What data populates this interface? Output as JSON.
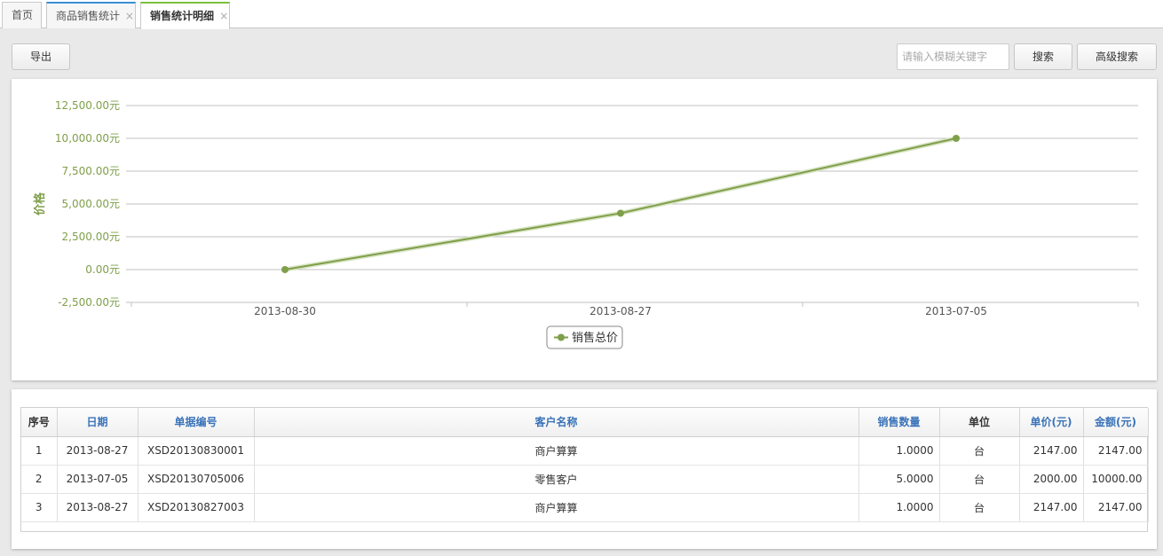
{
  "tabs": [
    {
      "label": "首页",
      "closable": false
    },
    {
      "label": "商品销售统计",
      "closable": true
    },
    {
      "label": "销售统计明细",
      "closable": true,
      "active": true
    }
  ],
  "tab_close_glyph": "×",
  "toolbar": {
    "export_label": "导出",
    "search_placeholder": "请输入模糊关键字",
    "search_value": "",
    "search_label": "搜索",
    "advanced_search_label": "高级搜索"
  },
  "chart_data": {
    "type": "line",
    "x": [
      "2013-08-30",
      "2013-08-27",
      "2013-07-05"
    ],
    "series": [
      {
        "name": "销售总价",
        "values": [
          0,
          4294,
          10000
        ],
        "color": "#7f9f4a"
      }
    ],
    "ylabel": "价格",
    "ylim": [
      -2500,
      12500
    ],
    "yticks": [
      12500,
      10000,
      7500,
      5000,
      2500,
      0,
      -2500
    ],
    "ytick_labels": [
      "12,500.00元",
      "10,000.00元",
      "7,500.00元",
      "5,000.00元",
      "2,500.00元",
      "0.00元",
      "-2,500.00元"
    ],
    "grid": true,
    "legend": "bottom-center",
    "axis_color": "#7f9f4a"
  },
  "table": {
    "columns": [
      "序号",
      "日期",
      "单据编号",
      "客户名称",
      "销售数量",
      "单位",
      "单价(元)",
      "金额(元)"
    ],
    "rows": [
      [
        "1",
        "2013-08-27",
        "XSD20130830001",
        "商户算算",
        "1.0000",
        "台",
        "2147.00",
        "2147.00"
      ],
      [
        "2",
        "2013-07-05",
        "XSD20130705006",
        "零售客户",
        "5.0000",
        "台",
        "2000.00",
        "10000.00"
      ],
      [
        "3",
        "2013-08-27",
        "XSD20130827003",
        "商户算算",
        "1.0000",
        "台",
        "2147.00",
        "2147.00"
      ]
    ]
  }
}
